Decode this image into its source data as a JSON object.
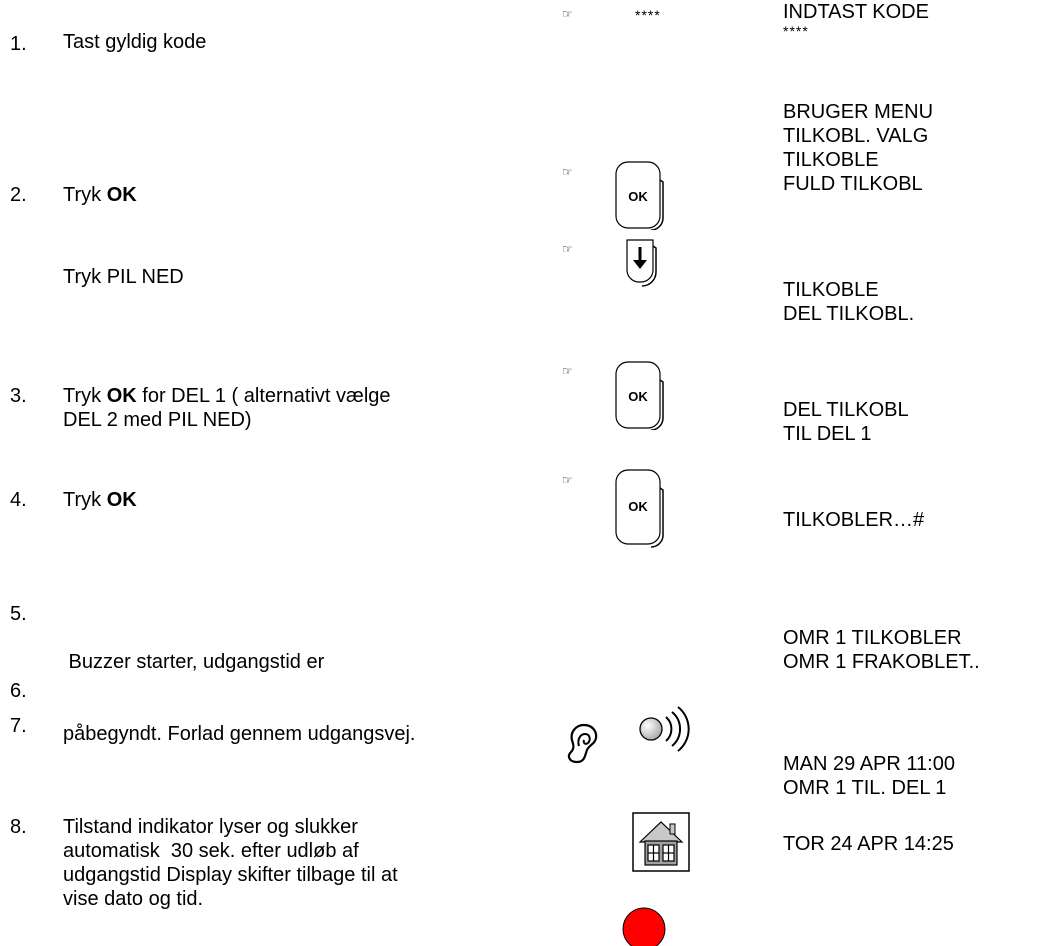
{
  "code_stars": "****",
  "steps": [
    {
      "number": "1.",
      "text": "Tast gyldig kode",
      "display": [
        "INDTAST KODE",
        "****"
      ]
    },
    {
      "number": "2.",
      "prefix": "Tryk ",
      "bold": "OK",
      "display": [
        "BRUGER MENU",
        "TILKOBL. VALG",
        "TILKOBLE",
        "FULD TILKOBL"
      ]
    },
    {
      "text": "Tryk PIL NED",
      "display": [
        "TILKOBLE",
        "DEL TILKOBL."
      ]
    },
    {
      "number": "3.",
      "prefix": "Tryk ",
      "bold": "OK",
      "suffix": " for DEL 1 ( alternativt vælge",
      "line2": "DEL 2 med PIL NED)",
      "display": [
        "DEL TILKOBL",
        "TIL DEL 1"
      ]
    },
    {
      "number": "4.",
      "prefix": "Tryk ",
      "bold": "OK",
      "display": [
        "TILKOBLER…#"
      ]
    },
    {
      "number": "5.",
      "lines": [
        " Buzzer starter, udgangstid er",
        "påbegyndt. Forlad gennem udgangsvej."
      ],
      "display": [
        "OMR 1 TILKOBLER",
        "OMR 1 FRAKOBLET.."
      ]
    },
    {
      "number": "6."
    },
    {
      "number": "7.",
      "display": [
        "MAN 29 APR 11:00",
        "OMR 1 TIL. DEL 1"
      ]
    },
    {
      "number": "8.",
      "lines": [
        "Tilstand indikator lyser og slukker",
        "automatisk  30 sek. efter udløb af",
        "udgangstid Display skifter tilbage til at",
        "vise dato og tid."
      ],
      "display": [
        "TOR 24 APR 14:25"
      ]
    }
  ],
  "keys": {
    "ok": "OK"
  },
  "icons": {
    "hand": "pointing-hand-icon",
    "ok_key": "ok-key-icon",
    "down_key": "down-arrow-key-icon",
    "ear": "ear-icon",
    "sound": "sound-waves-icon",
    "house": "house-icon",
    "led": "red-led-icon"
  },
  "colors": {
    "led": "#ff0000",
    "house_roof": "#c8c8c8",
    "house_body": "#a0a0a0"
  }
}
